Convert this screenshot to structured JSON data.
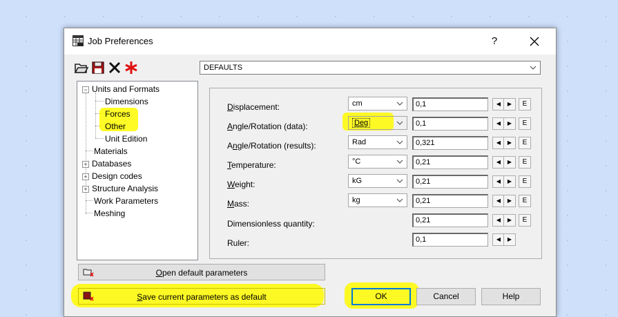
{
  "window": {
    "title": "Job Preferences",
    "help": "?",
    "close": "✕"
  },
  "toolbar": {
    "open": "open-folder-icon",
    "save": "floppy-disk-icon",
    "delete": "x-icon",
    "reset": "red-star-icon"
  },
  "profile": {
    "selected": "DEFAULTS"
  },
  "tree": {
    "units_and_formats": "Units and Formats",
    "dimensions": "Dimensions",
    "forces": "Forces",
    "other": "Other",
    "unit_edition": "Unit Edition",
    "materials": "Materials",
    "databases": "Databases",
    "design_codes": "Design codes",
    "structure_analysis": "Structure Analysis",
    "work_parameters": "Work Parameters",
    "meshing": "Meshing"
  },
  "params": [
    {
      "label_u": "D",
      "label_rest": "isplacement:",
      "unit": "cm",
      "value": "0,1",
      "edit": "E"
    },
    {
      "label_u": "A",
      "label_rest": "ngle/Rotation (data):",
      "unit": "Deg",
      "value": "0,1",
      "edit": "E"
    },
    {
      "label_pre": "A",
      "label_u": "n",
      "label_rest": "gle/Rotation (results):",
      "unit": "Rad",
      "value": "0,321",
      "edit": "E"
    },
    {
      "label_u": "T",
      "label_rest": "emperature:",
      "unit": "°C",
      "value": "0,21",
      "edit": "E"
    },
    {
      "label_u": "W",
      "label_rest": "eight:",
      "unit": "kG",
      "value": "0,21",
      "edit": "E"
    },
    {
      "label_u": "M",
      "label_rest": "ass:",
      "unit": "kg",
      "value": "0,21",
      "edit": "E"
    },
    {
      "label_rest": "Dimensionless quantity:",
      "value": "0,21",
      "edit": "E"
    },
    {
      "label_rest": "Ruler:",
      "value": "0,1"
    }
  ],
  "spin": {
    "left": "◀",
    "right": "▶"
  },
  "buttons": {
    "open_default_u": "O",
    "open_default_rest": "pen default parameters",
    "save_default_u": "S",
    "save_default_rest": "ave current parameters as default",
    "ok": "OK",
    "cancel": "Cancel",
    "help": "Help"
  },
  "colors": {
    "highlight": "#fffa00",
    "focus": "#0078d7"
  }
}
